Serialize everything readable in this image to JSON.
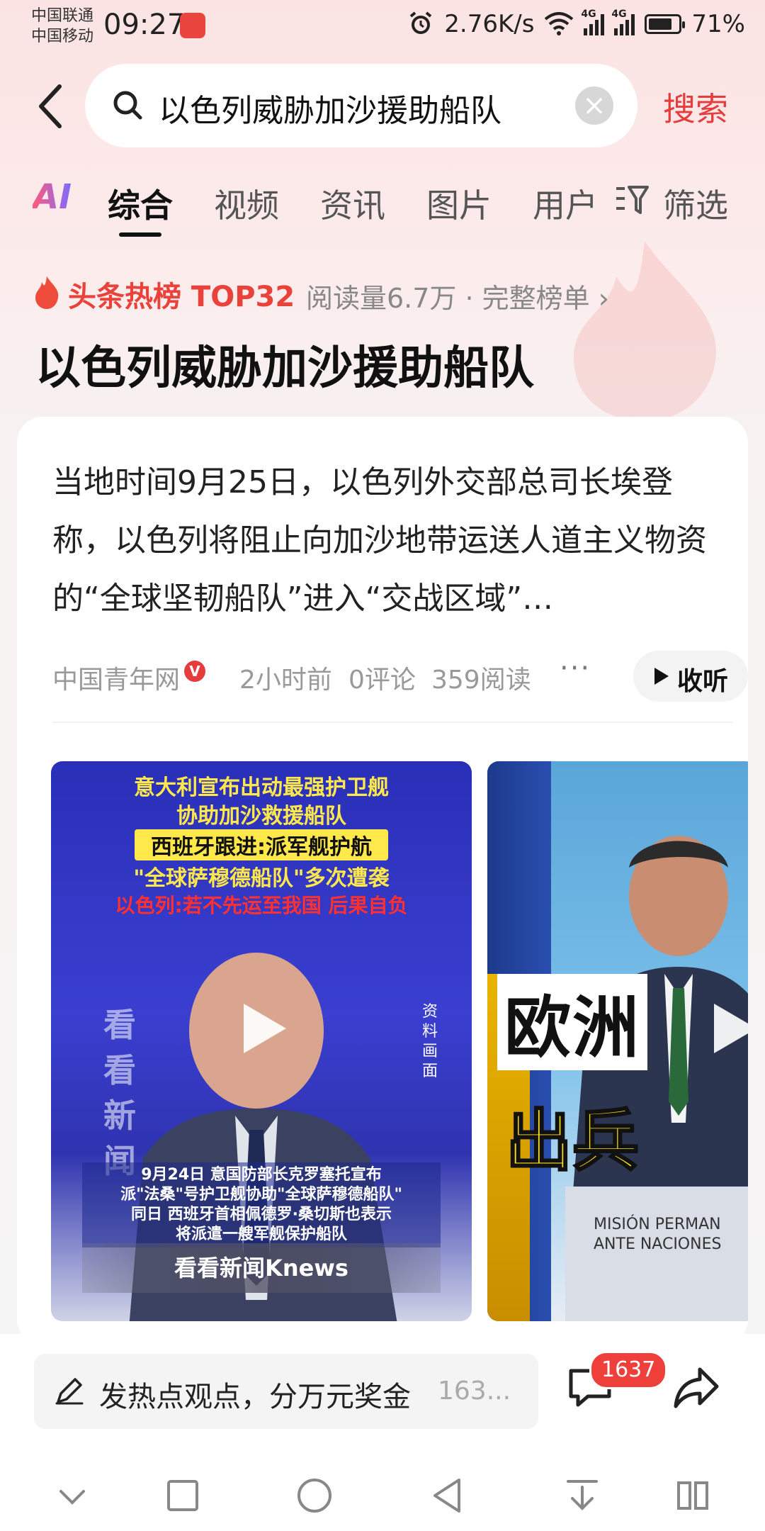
{
  "status_bar": {
    "carrier1": "中国联通",
    "carrier2": "中国移动",
    "time": "09:27",
    "net_speed": "2.76K/s",
    "signal1_label": "4G",
    "signal2_label": "4G",
    "battery": "71%"
  },
  "search": {
    "query": "以色列威胁加沙援助船队",
    "button": "搜索"
  },
  "tabs": {
    "ai": "AI",
    "items": [
      "综合",
      "视频",
      "资讯",
      "图片",
      "用户"
    ],
    "active": "综合",
    "filter": "筛选"
  },
  "hot": {
    "label": "头条热榜 TOP32",
    "meta": "阅读量6.7万 · 完整榜单 ›",
    "title": "以色列威胁加沙援助船队"
  },
  "article": {
    "body": "当地时间9月25日，以色列外交部总司长埃登称，以色列将阻止向加沙地带运送人道主义物资的“全球坚韧船队”进入“交战区域”…",
    "source": "中国青年网",
    "verified": "V",
    "time": "2小时前",
    "comments": "0评论",
    "reads": "359阅读",
    "more": "···",
    "listen": "收听"
  },
  "video1": {
    "cap1": "意大利宣布出动最强护卫舰",
    "cap2": "协助加沙救援船队",
    "cap3": "西班牙跟进:派军舰护航",
    "cap4": "\"全球萨穆德船队\"多次遭袭",
    "cap5": "以色列:若不先运至我国 后果自负",
    "watermark": "看看新闻",
    "side": "资料画面",
    "bottom1": "9月24日 意国防部长克罗塞托宣布",
    "bottom2": "派\"法桑\"号护卫舰协助\"全球萨穆德船队\"",
    "bottom3": "同日 西班牙首相佩德罗·桑切斯也表示",
    "bottom4": "将派遣一艘军舰保护船队",
    "logo": "看看新闻Knews"
  },
  "video2": {
    "cap1": "欧洲",
    "cap2": "出兵",
    "podium1": "MISIÓN PERMAN",
    "podium2": "ANTE NACIONES"
  },
  "bottom": {
    "placeholder": "发热点观点，分万元奖金",
    "placeholder_tail": "163...",
    "comment_count": "1637"
  },
  "colors": {
    "accent": "#e53d3d",
    "badge": "#ef3f3b",
    "hot": "#e9423a"
  }
}
